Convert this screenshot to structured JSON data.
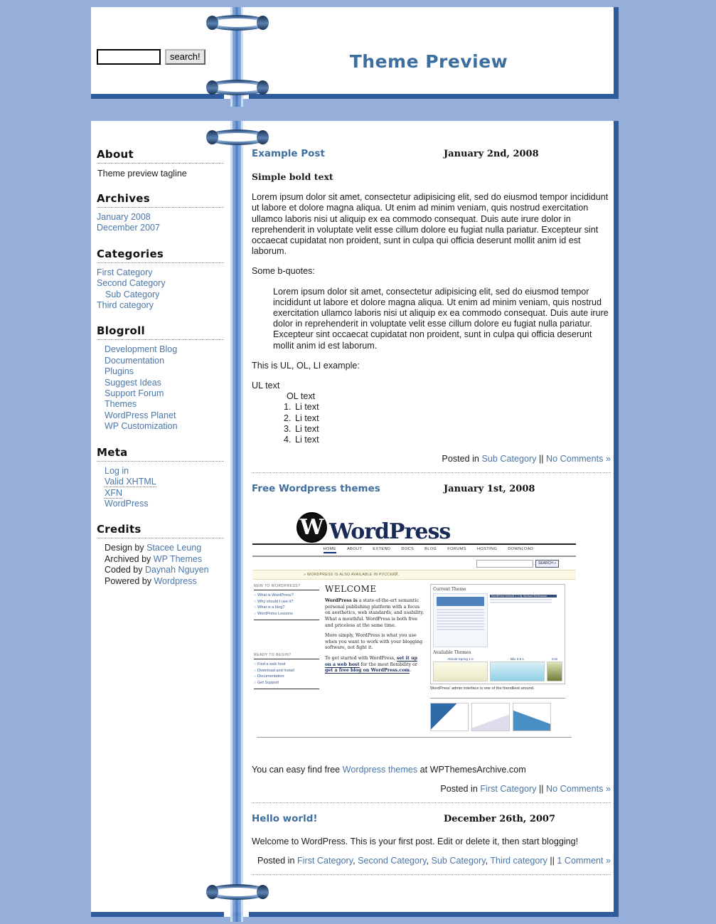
{
  "header": {
    "site_title": "Theme Preview",
    "search": {
      "value": "",
      "placeholder": "",
      "button_label": "search!"
    }
  },
  "sidebar": {
    "sections": [
      {
        "heading": "About",
        "type": "text",
        "text": "Theme preview tagline"
      },
      {
        "heading": "Archives",
        "type": "links",
        "items": [
          {
            "label": "January 2008"
          },
          {
            "label": "December 2007"
          }
        ]
      },
      {
        "heading": "Categories",
        "type": "links",
        "items": [
          {
            "label": "First Category"
          },
          {
            "label": "Second Category"
          },
          {
            "label": "Sub Category",
            "sub": true
          },
          {
            "label": "Third category"
          }
        ]
      },
      {
        "heading": "Blogroll",
        "type": "links-indented",
        "items": [
          {
            "label": "Development Blog"
          },
          {
            "label": "Documentation"
          },
          {
            "label": "Plugins"
          },
          {
            "label": "Suggest Ideas"
          },
          {
            "label": "Support Forum"
          },
          {
            "label": "Themes"
          },
          {
            "label": "WordPress Planet"
          },
          {
            "label": "WP Customization"
          }
        ]
      },
      {
        "heading": "Meta",
        "type": "links-indented",
        "items": [
          {
            "label": "Log in"
          },
          {
            "label": "Valid XHTML",
            "abbr": true
          },
          {
            "label": "XFN",
            "abbr": true
          },
          {
            "label": "WordPress"
          }
        ]
      },
      {
        "heading": "Credits",
        "type": "credits",
        "credits": [
          {
            "prefix": "Design by ",
            "link": "Stacee Leung"
          },
          {
            "prefix": "Archived by ",
            "link": "WP Themes"
          },
          {
            "prefix": "Coded by ",
            "link": "Daynah Nguyen"
          },
          {
            "prefix": "Powered by ",
            "link": "Wordpress"
          }
        ]
      }
    ]
  },
  "posts": [
    {
      "title": "Example Post",
      "date": "January 2nd, 2008",
      "bold_lead": "Simple bold text",
      "paragraph1": "Lorem ipsum dolor sit amet, consectetur adipisicing elit, sed do eiusmod tempor incididunt ut labore et dolore magna aliqua. Ut enim ad minim veniam, quis nostrud exercitation ullamco laboris nisi ut aliquip ex ea commodo consequat. Duis aute irure dolor in reprehenderit in voluptate velit esse cillum dolore eu fugiat nulla pariatur. Excepteur sint occaecat cupidatat non proident, sunt in culpa qui officia deserunt mollit anim id est laborum.",
      "quote_intro": "Some b-quotes:",
      "blockquote": "Lorem ipsum dolor sit amet, consectetur adipisicing elit, sed do eiusmod tempor incididunt ut labore et dolore magna aliqua. Ut enim ad minim veniam, quis nostrud exercitation ullamco laboris nisi ut aliquip ex ea commodo consequat. Duis aute irure dolor in reprehenderit in voluptate velit esse cillum dolore eu fugiat nulla pariatur. Excepteur sint occaecat cupidatat non proident, sunt in culpa qui officia deserunt mollit anim id est laborum.",
      "list_intro": "This is UL, OL, LI example:",
      "ul_text": "UL text",
      "ol_text": "OL text",
      "li_items": [
        "Li text",
        "Li text",
        "Li text",
        "Li text"
      ],
      "meta": {
        "posted_in_label": "Posted in ",
        "categories": [
          "Sub Category"
        ],
        "separator": " || ",
        "comments": "No Comments »"
      }
    },
    {
      "title": "Free Wordpress themes",
      "date": "January 1st, 2008",
      "caption_prefix": "You can easy find free ",
      "caption_link": "Wordpress themes",
      "caption_suffix": " at WPThemesArchive.com",
      "meta": {
        "posted_in_label": "Posted in ",
        "categories": [
          "First Category"
        ],
        "separator": " || ",
        "comments": "No Comments »"
      }
    },
    {
      "title": "Hello world!",
      "date": "December 26th, 2007",
      "paragraph1": "Welcome to WordPress. This is your first post. Edit or delete it, then start blogging!",
      "meta": {
        "posted_in_label": "Posted in ",
        "categories": [
          "First Category",
          "Second Category",
          "Sub Category",
          "Third category"
        ],
        "separator": " || ",
        "comments": "1 Comment »"
      }
    }
  ],
  "wp_screenshot": {
    "logo_word": "WordPress",
    "logo_mark": "W",
    "nav": [
      "HOME",
      "ABOUT",
      "EXTEND",
      "DOCS",
      "BLOG",
      "FORUMS",
      "HOSTING",
      "DOWNLOAD"
    ],
    "search_button": "SEARCH »",
    "notice": "» WORDPRESS IS ALSO AVAILABLE IN РУССКИЙ.",
    "left_sections": [
      {
        "title": "NEW TO WORDPRESS?",
        "items": [
          "What is WordPress?",
          "Why should I use it?",
          "What is a blog?",
          "WordPress Lessons"
        ]
      },
      {
        "title": "READY TO BEGIN?",
        "items": [
          "Find a web host",
          "Download and Install",
          "Documentation",
          "Get Support"
        ]
      }
    ],
    "welcome_heading": "WELCOME",
    "welcome_p1_bold": "WordPress is",
    "welcome_p1": " a state-of-the-art semantic personal publishing platform with a focus on aesthetics, web standards, and usability. What a mouthful. WordPress is both free and priceless at the same time.",
    "welcome_p2": "More simply, WordPress is what you use when you want to work with your blogging software, not fight it.",
    "welcome_p3_prefix": "To get started with WordPress, ",
    "welcome_p3_link1": "set it up on a web host",
    "welcome_p3_mid": " for the most flexibility or ",
    "welcome_p3_link2": "get a free blog on WordPress.com",
    "welcome_p3_end": ".",
    "panel_current": "Current Theme",
    "panel_current_note": "WordPress Default 1.5 by Michael Heilemann",
    "panel_available": "Available Themes",
    "theme_labels": [
      "Almost Spring 1.0",
      "Blix 0.9.1",
      "Con"
    ],
    "caption": "WordPress' admin interface is one of the friendliest around."
  },
  "colors": {
    "background": "#95afda",
    "page_border": "#2f5d9c",
    "title": "#3d6ea0",
    "link": "#4a76a8",
    "text": "#1b1b1b"
  }
}
